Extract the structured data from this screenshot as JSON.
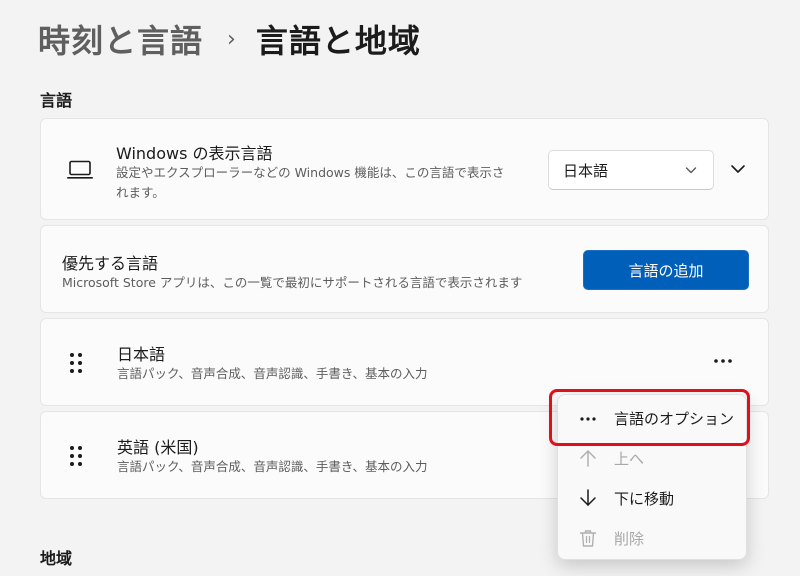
{
  "breadcrumb": {
    "parent": "時刻と言語",
    "separator": "›",
    "current": "言語と地域"
  },
  "sections": {
    "language": "言語",
    "region": "地域"
  },
  "display_language": {
    "title": "Windows の表示言語",
    "desc_line1": "設定やエクスプローラーなどの Windows 機能は、この言語で表示さ",
    "desc_line2": "れます。",
    "selected": "日本語",
    "icon": "monitor-icon"
  },
  "preferred": {
    "title": "優先する言語",
    "desc": "Microsoft Store アプリは、この一覧で最初にサポートされる言語で表示されます",
    "add_button": "言語の追加"
  },
  "languages": [
    {
      "name": "日本語",
      "features": "言語パック、音声合成、音声認識、手書き、基本の入力"
    },
    {
      "name": "英語 (米国)",
      "features": "言語パック、音声合成、音声認識、手書き、基本の入力"
    }
  ],
  "context_menu": {
    "options": "言語のオプション",
    "move_up": "上へ",
    "move_down": "下に移動",
    "remove": "削除"
  },
  "colors": {
    "accent": "#005fb8",
    "highlight": "#e0101a"
  }
}
